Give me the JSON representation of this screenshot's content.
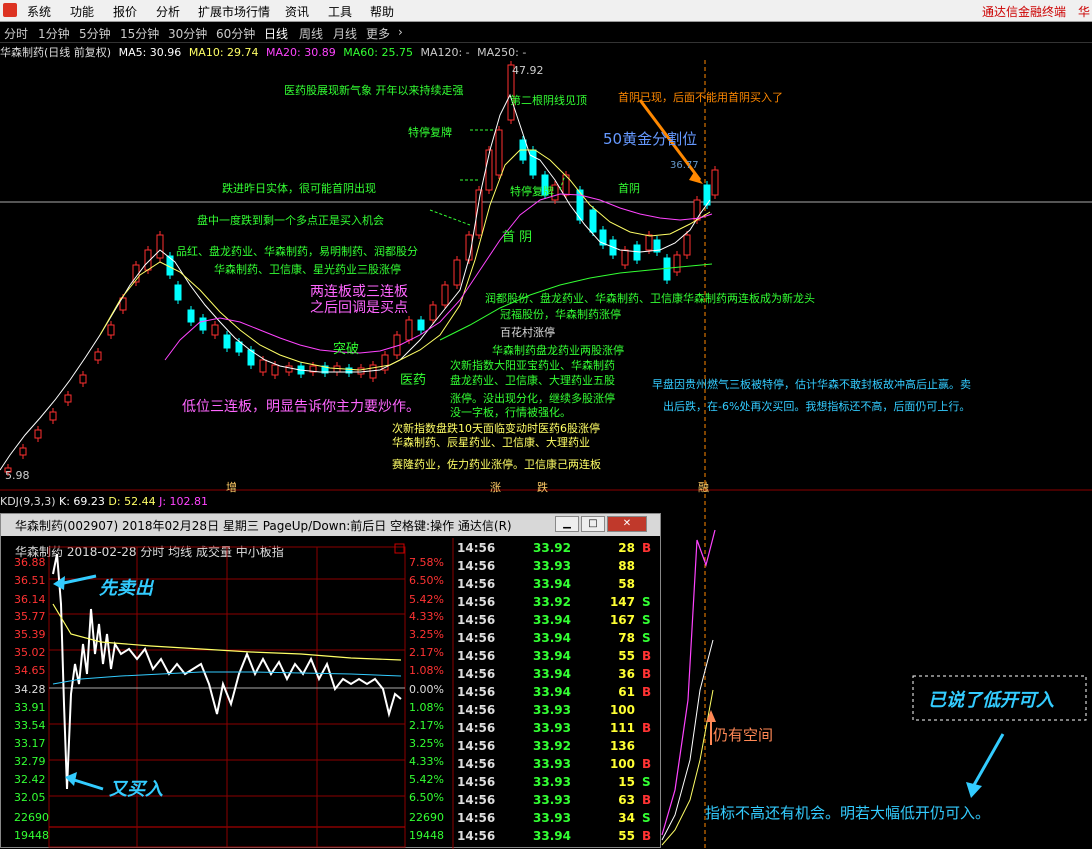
{
  "menu": {
    "items": [
      "系统",
      "功能",
      "报价",
      "分析",
      "扩展市场行情",
      "资讯",
      "工具",
      "帮助"
    ],
    "right": [
      "通达信金融终端",
      "华"
    ]
  },
  "periods": [
    "分时",
    "1分钟",
    "5分钟",
    "15分钟",
    "30分钟",
    "60分钟",
    "日线",
    "周线",
    "月线",
    "更多",
    "›"
  ],
  "active_period": "日线",
  "ma_bar": {
    "stock": "华森制药(日线 前复权)",
    "ma5": "MA5: 30.96",
    "ma10": "MA10: 29.74",
    "ma20": "MA20: 30.89",
    "ma60": "MA60: 25.75",
    "ma120": "MA120: -",
    "ma250": "MA250: -"
  },
  "chart": {
    "high_label": "47.92",
    "low_label": "5.98",
    "level_label": "36.77",
    "markers": [
      "增",
      "涨",
      "跌",
      "融"
    ],
    "kdj": {
      "title": "KDJ(9,3,3)",
      "k": "K: 69.23",
      "d": "D: 52.44",
      "j": "J: 102.81"
    }
  },
  "annotations": {
    "a1": "医药股展现新气象 开年以来持续走强",
    "a2": "第二根阴线见顶",
    "a3": "首阴已现，后面不能用首阴买入了",
    "a4": "特停复牌",
    "a5": "50黄金分割位",
    "a6": "跌进昨日实体，很可能首阴出现",
    "a7": "特停复牌",
    "a8": "首阴",
    "a9": "盘中一度跌到剩一个多点正是买入机会",
    "a10": "首 阴",
    "a11": "品红、盘龙药业、华森制药，易明制药、润都股分",
    "a12": "华森制药、卫信康、星光药业三股涨停",
    "a13": "两连板或三连板",
    "a14": "之后回调是买点",
    "a15": "润都股份、盘龙药业、华森制药、卫信康华森制药两连板成为新龙头",
    "a16": "冠福股份，华森制药涨停",
    "a17": "百花村涨停",
    "a18": "华森制药盘龙药业两股涨停",
    "a19": "突破",
    "a20": "医药",
    "a21": "次新指数大阳亚宝药业、华森制药",
    "a22": "盘龙药业、卫信康、大理药业五股",
    "a23": "涨停。没出现分化，继续多股涨停",
    "a24": "没一字板，行情被强化。",
    "a25": "低位三连板，明显告诉你主力要炒作。",
    "a26": "次新指数盘跌10天面临变动时医药6股涨停",
    "a27": "华森制药、辰星药业、卫信康、大理药业",
    "a28": "赛隆药业，佐力药业涨停。卫信康己两连板",
    "a29": "早盘因贵州燃气三板被特停，估计华森不敢封板故冲高后止赢。卖",
    "a30": "出后跌，在-6%处再次买回。我想指标还不高，后面仍可上行。"
  },
  "window": {
    "title": "华森制药(002907) 2018年02月28日 星期三 PageUp/Down:前后日 空格键:操作 通达信(R)",
    "header": "华森制药  2018-02-28 分时  均线  成交量  中小板指",
    "left_scale": [
      "36.88",
      "36.51",
      "36.14",
      "35.77",
      "35.39",
      "35.02",
      "34.65",
      "34.28",
      "33.91",
      "33.54",
      "33.17",
      "32.79",
      "32.42",
      "32.05",
      "22690",
      "19448"
    ],
    "right_scale": [
      "7.58%",
      "6.50%",
      "5.42%",
      "4.33%",
      "3.25%",
      "2.17%",
      "1.08%",
      "0.00%",
      "1.08%",
      "2.17%",
      "3.25%",
      "4.33%",
      "5.42%",
      "6.50%",
      "22690",
      "19448"
    ],
    "ticks": [
      {
        "t": "14:56",
        "p": "33.92",
        "v": "28",
        "bs": "B"
      },
      {
        "t": "14:56",
        "p": "33.93",
        "v": "88",
        "bs": ""
      },
      {
        "t": "14:56",
        "p": "33.94",
        "v": "58",
        "bs": ""
      },
      {
        "t": "14:56",
        "p": "33.92",
        "v": "147",
        "bs": "S"
      },
      {
        "t": "14:56",
        "p": "33.94",
        "v": "167",
        "bs": "S"
      },
      {
        "t": "14:56",
        "p": "33.94",
        "v": "78",
        "bs": "S"
      },
      {
        "t": "14:56",
        "p": "33.94",
        "v": "55",
        "bs": "B"
      },
      {
        "t": "14:56",
        "p": "33.94",
        "v": "36",
        "bs": "B"
      },
      {
        "t": "14:56",
        "p": "33.94",
        "v": "61",
        "bs": "B"
      },
      {
        "t": "14:56",
        "p": "33.93",
        "v": "100",
        "bs": ""
      },
      {
        "t": "14:56",
        "p": "33.93",
        "v": "111",
        "bs": "B"
      },
      {
        "t": "14:56",
        "p": "33.92",
        "v": "136",
        "bs": ""
      },
      {
        "t": "14:56",
        "p": "33.93",
        "v": "100",
        "bs": "B"
      },
      {
        "t": "14:56",
        "p": "33.93",
        "v": "15",
        "bs": "S"
      },
      {
        "t": "14:56",
        "p": "33.93",
        "v": "63",
        "bs": "B"
      },
      {
        "t": "14:56",
        "p": "33.93",
        "v": "34",
        "bs": "S"
      },
      {
        "t": "14:56",
        "p": "33.94",
        "v": "55",
        "bs": "B"
      }
    ],
    "note_sell": "先卖出",
    "note_buy": "又买入"
  },
  "right_panel": {
    "space": "仍有空间",
    "box": "已说了低开可入",
    "bottom": "指标不高还有机会。明若大幅低开仍可入。"
  },
  "colors": {
    "up": "#ff3030",
    "down": "#00ffff",
    "ma5": "#ffffff",
    "ma10": "#ffff66",
    "ma20": "#ff44ff",
    "ma60": "#33ff33",
    "grid": "#8b0000"
  }
}
